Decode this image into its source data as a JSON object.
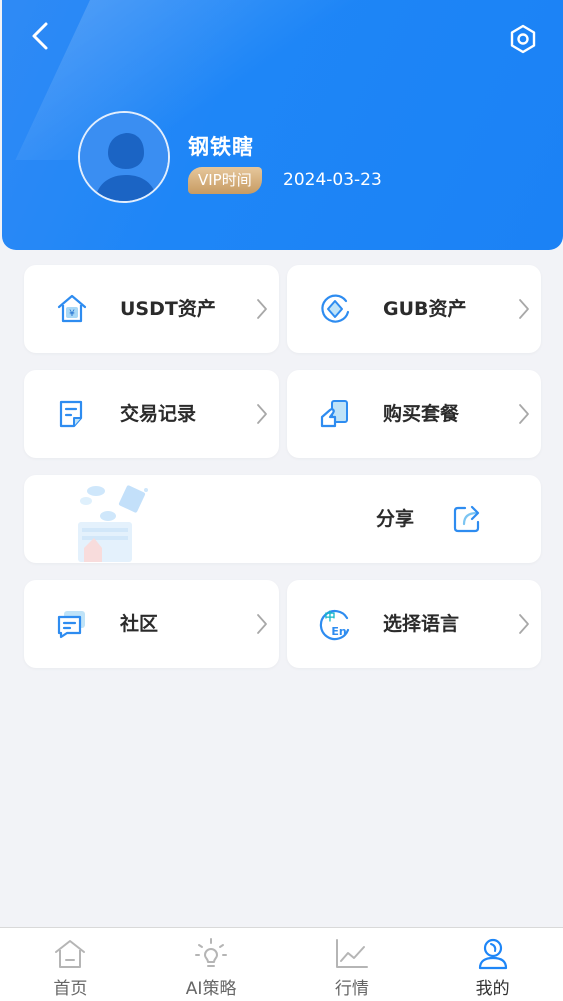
{
  "header": {
    "back_icon": "chevron-left-icon",
    "settings_icon": "hexagon-settings-icon",
    "username": "钢铁瞎",
    "vip_label": "VIP时间",
    "vip_date": "2024-03-23"
  },
  "menu": {
    "usdt_assets": "USDT资产",
    "gub_assets": "GUB资产",
    "transactions": "交易记录",
    "buy_package": "购买套餐",
    "share": "分享",
    "community": "社区",
    "language": "选择语言"
  },
  "tabs": [
    {
      "label": "首页",
      "icon": "home-icon"
    },
    {
      "label": "AI策略",
      "icon": "lightbulb-icon"
    },
    {
      "label": "行情",
      "icon": "chart-icon"
    },
    {
      "label": "我的",
      "icon": "user-icon"
    }
  ],
  "colors": {
    "header_blue": "#1e86f7",
    "icon_blue": "#2e8cf0",
    "vip_gold": "#c79b63",
    "tab_active": "#1e86f7",
    "tab_inactive": "#b5b5b5"
  }
}
